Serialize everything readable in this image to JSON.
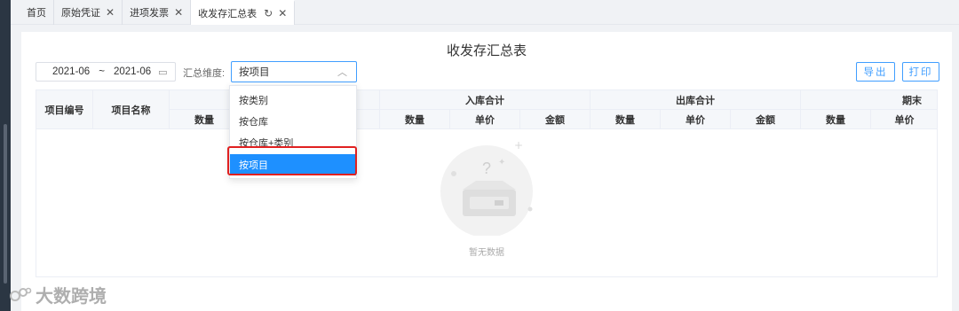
{
  "tabs": [
    {
      "label": "首页"
    },
    {
      "label": "原始凭证"
    },
    {
      "label": "进项发票"
    },
    {
      "label": "收发存汇总表"
    }
  ],
  "page_title": "收发存汇总表",
  "date_range": {
    "start": "2021-06",
    "separator": "~",
    "end": "2021-06"
  },
  "dimension": {
    "label": "汇总维度:",
    "value": "按项目"
  },
  "dropdown_options": [
    {
      "label": "按类别"
    },
    {
      "label": "按仓库"
    },
    {
      "label": "按仓库+类别"
    },
    {
      "label": "按项目"
    }
  ],
  "buttons": {
    "export": "导出",
    "print": "打印"
  },
  "table": {
    "col_project_no": "项目编号",
    "col_project_name": "项目名称",
    "group_opening": "",
    "group_in": "入库合计",
    "group_out": "出库合计",
    "group_end": "期末",
    "sub_qty": "数量",
    "sub_price": "单价",
    "sub_amount": "金额"
  },
  "empty_text": "暂无数据",
  "watermark": "大数跨境",
  "colors": {
    "accent": "#409eff",
    "selected": "#1e90ff",
    "highlight": "#e02020"
  }
}
